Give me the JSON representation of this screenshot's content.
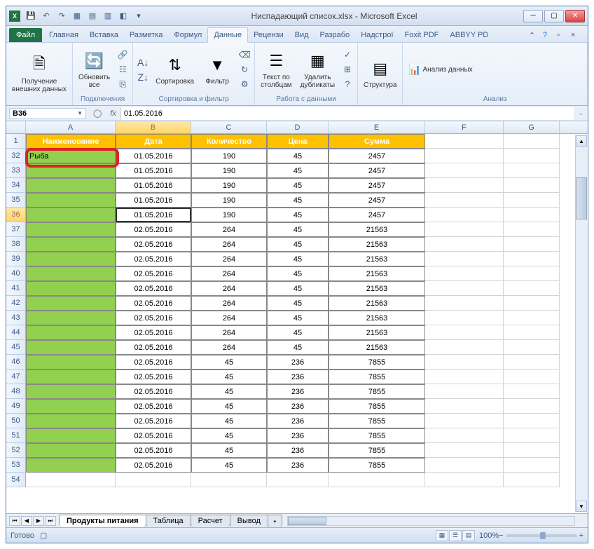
{
  "window": {
    "title": "Ниспадающий список.xlsx - Microsoft Excel"
  },
  "qat": [
    "save",
    "undo",
    "redo",
    "q1",
    "q2",
    "q3",
    "q4",
    "q5",
    "q6"
  ],
  "tabs": {
    "file": "Файл",
    "items": [
      "Главная",
      "Вставка",
      "Разметка",
      "Формул",
      "Данные",
      "Рецензи",
      "Вид",
      "Разрабо",
      "Надстрої",
      "Foxit PDF",
      "ABBYY PD"
    ],
    "active_index": 4
  },
  "ribbon": {
    "external": {
      "label": "Получение\nвнешних данных",
      "sub": ""
    },
    "connections": {
      "refresh": "Обновить\nвсе",
      "group": "Подключения"
    },
    "sort": {
      "sort": "Сортировка",
      "filter": "Фильтр",
      "group": "Сортировка и фильтр"
    },
    "datatools": {
      "text": "Текст по\nстолбцам",
      "dup": "Удалить\nдубликаты",
      "group": "Работа с данными"
    },
    "outline": {
      "btn": "Структура"
    },
    "analysis": {
      "btn": "Анализ данных",
      "group": "Анализ"
    }
  },
  "formula_bar": {
    "name_box": "B36",
    "formula": "01.05.2016"
  },
  "columns": [
    "A",
    "B",
    "C",
    "D",
    "E",
    "F",
    "G"
  ],
  "selected_col": "B",
  "table": {
    "headers": [
      "Наименование",
      "Дата",
      "Количество",
      "Цена",
      "Сумма"
    ],
    "first_row_label": "Рыба",
    "row_numbers": [
      1,
      32,
      33,
      34,
      35,
      36,
      37,
      38,
      39,
      40,
      41,
      42,
      43,
      44,
      45,
      46,
      47,
      48,
      49,
      50,
      51,
      52,
      53,
      54
    ],
    "selected_row": 36,
    "rows": [
      {
        "a": "Рыба",
        "b": "01.05.2016",
        "c": "190",
        "d": "45",
        "e": "2457"
      },
      {
        "a": "",
        "b": "01.05.2016",
        "c": "190",
        "d": "45",
        "e": "2457"
      },
      {
        "a": "",
        "b": "01.05.2016",
        "c": "190",
        "d": "45",
        "e": "2457"
      },
      {
        "a": "",
        "b": "01.05.2016",
        "c": "190",
        "d": "45",
        "e": "2457"
      },
      {
        "a": "",
        "b": "01.05.2016",
        "c": "190",
        "d": "45",
        "e": "2457"
      },
      {
        "a": "",
        "b": "02.05.2016",
        "c": "264",
        "d": "45",
        "e": "21563"
      },
      {
        "a": "",
        "b": "02.05.2016",
        "c": "264",
        "d": "45",
        "e": "21563"
      },
      {
        "a": "",
        "b": "02.05.2016",
        "c": "264",
        "d": "45",
        "e": "21563"
      },
      {
        "a": "",
        "b": "02.05.2016",
        "c": "264",
        "d": "45",
        "e": "21563"
      },
      {
        "a": "",
        "b": "02.05.2016",
        "c": "264",
        "d": "45",
        "e": "21563"
      },
      {
        "a": "",
        "b": "02.05.2016",
        "c": "264",
        "d": "45",
        "e": "21563"
      },
      {
        "a": "",
        "b": "02.05.2016",
        "c": "264",
        "d": "45",
        "e": "21563"
      },
      {
        "a": "",
        "b": "02.05.2016",
        "c": "264",
        "d": "45",
        "e": "21563"
      },
      {
        "a": "",
        "b": "02.05.2016",
        "c": "264",
        "d": "45",
        "e": "21563"
      },
      {
        "a": "",
        "b": "02.05.2016",
        "c": "45",
        "d": "236",
        "e": "7855"
      },
      {
        "a": "",
        "b": "02.05.2016",
        "c": "45",
        "d": "236",
        "e": "7855"
      },
      {
        "a": "",
        "b": "02.05.2016",
        "c": "45",
        "d": "236",
        "e": "7855"
      },
      {
        "a": "",
        "b": "02.05.2016",
        "c": "45",
        "d": "236",
        "e": "7855"
      },
      {
        "a": "",
        "b": "02.05.2016",
        "c": "45",
        "d": "236",
        "e": "7855"
      },
      {
        "a": "",
        "b": "02.05.2016",
        "c": "45",
        "d": "236",
        "e": "7855"
      },
      {
        "a": "",
        "b": "02.05.2016",
        "c": "45",
        "d": "236",
        "e": "7855"
      },
      {
        "a": "",
        "b": "02.05.2016",
        "c": "45",
        "d": "236",
        "e": "7855"
      }
    ]
  },
  "sheets": {
    "items": [
      "Продукты питания",
      "Таблица",
      "Расчет",
      "Вывод"
    ],
    "active_index": 0
  },
  "status": {
    "ready": "Готово",
    "zoom": "100%"
  }
}
